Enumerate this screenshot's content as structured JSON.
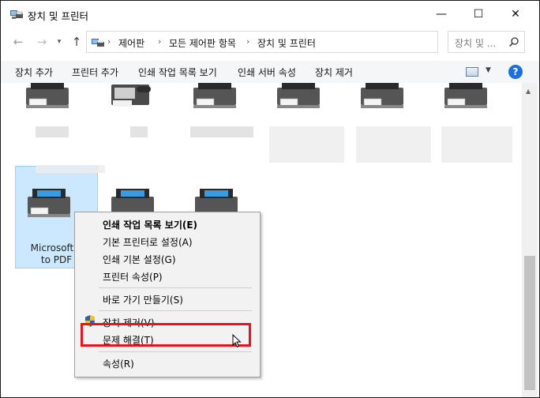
{
  "window": {
    "title": "장치 및 프린터",
    "min_glyph": "—",
    "max_glyph": "☐",
    "close_glyph": "✕"
  },
  "nav": {
    "back_glyph": "←",
    "forward_glyph": "→",
    "recent_glyph": "▾",
    "up_glyph": "↑",
    "breadcrumbs": [
      "제어판",
      "모든 제어판 항목",
      "장치 및 프린터"
    ],
    "crumb_sep": "›",
    "dropdown_glyph": "▾",
    "refresh_glyph": "↻",
    "search_placeholder": "장치 및 ..."
  },
  "commands": [
    "장치 추가",
    "프린터 추가",
    "인쇄 작업 목록 보기",
    "인쇄 서버 속성",
    "장치 제거"
  ],
  "view": {
    "drop_glyph": "▼",
    "help_glyph": "?"
  },
  "selected_device": {
    "label_line1": "Microsoft P",
    "label_line2": "to PDF"
  },
  "context_menu": {
    "items": [
      {
        "label": "인쇄 작업 목록 보기(E)",
        "bold": true
      },
      {
        "label": "기본 프린터로 설정(A)"
      },
      {
        "label": "인쇄 기본 설정(G)"
      },
      {
        "label": "프린터 속성(P)"
      },
      {
        "label": "바로 가기 만들기(S)"
      },
      {
        "label": "장치 제거(V)"
      },
      {
        "label": "문제 해결(T)"
      },
      {
        "label": "속성(R)"
      }
    ]
  },
  "scrollbar": {
    "up_glyph": "▲"
  },
  "colors": {
    "highlight": "#e8141c",
    "selection": "#cce8ff",
    "help": "#1e6fd9"
  }
}
